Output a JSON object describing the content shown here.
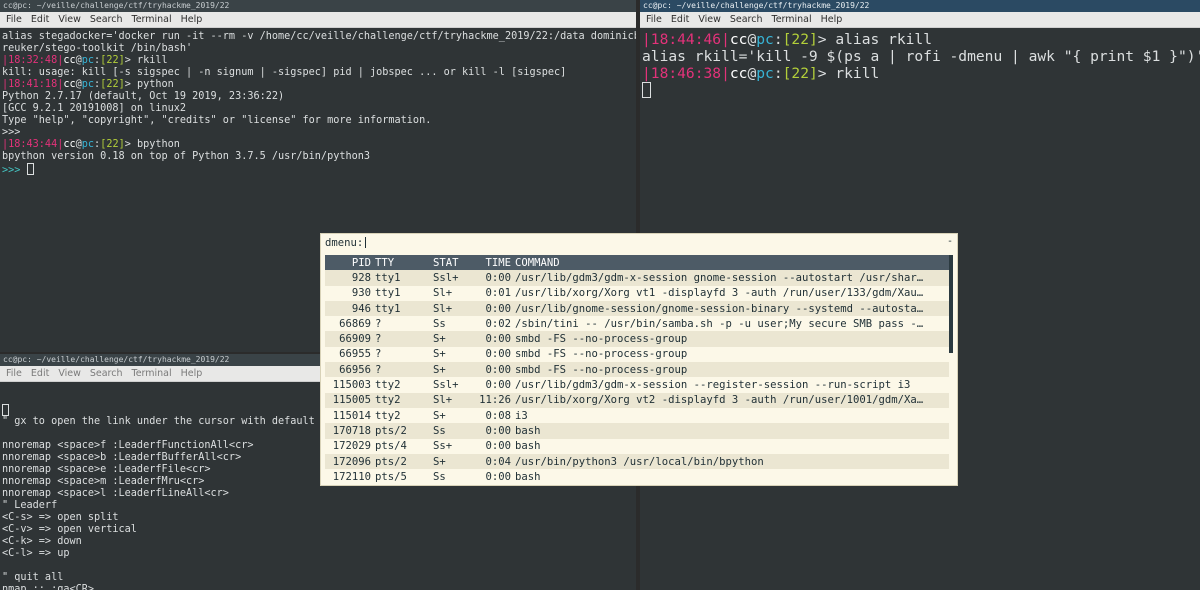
{
  "win_top_left": {
    "title": "cc@pc: ~/veille/challenge/ctf/tryhackme_2019/22",
    "menu": [
      "File",
      "Edit",
      "View",
      "Search",
      "Terminal",
      "Help"
    ],
    "lines": [
      {
        "segs": [
          {
            "t": "alias stegadocker='docker run -it --rm -v /home/cc/veille/challenge/ctf/tryhackme_2019/22:/data dominicb",
            "c": ""
          }
        ]
      },
      {
        "segs": [
          {
            "t": "reuker/stego-toolkit /bin/bash'",
            "c": ""
          }
        ]
      },
      {
        "segs": [
          {
            "t": "|18:32:48|",
            "c": "t-pink"
          },
          {
            "t": "cc",
            "c": "t-white"
          },
          {
            "t": "@",
            "c": ""
          },
          {
            "t": "pc",
            "c": "t-cyan"
          },
          {
            "t": ":",
            "c": ""
          },
          {
            "t": "[22]",
            "c": "t-green"
          },
          {
            "t": "> rkill",
            "c": ""
          }
        ]
      },
      {
        "segs": [
          {
            "t": "kill: usage: kill [-s sigspec | -n signum | -sigspec] pid | jobspec ... or kill -l [sigspec]",
            "c": ""
          }
        ]
      },
      {
        "segs": [
          {
            "t": "|18:41:18|",
            "c": "t-pink"
          },
          {
            "t": "cc",
            "c": "t-white"
          },
          {
            "t": "@",
            "c": ""
          },
          {
            "t": "pc",
            "c": "t-cyan"
          },
          {
            "t": ":",
            "c": ""
          },
          {
            "t": "[22]",
            "c": "t-green"
          },
          {
            "t": "> python",
            "c": ""
          }
        ]
      },
      {
        "segs": [
          {
            "t": "Python 2.7.17 (default, Oct 19 2019, 23:36:22)",
            "c": ""
          }
        ]
      },
      {
        "segs": [
          {
            "t": "[GCC 9.2.1 20191008] on linux2",
            "c": ""
          }
        ]
      },
      {
        "segs": [
          {
            "t": "Type \"help\", \"copyright\", \"credits\" or \"license\" for more information.",
            "c": ""
          }
        ]
      },
      {
        "segs": [
          {
            "t": ">>>",
            "c": ""
          }
        ]
      },
      {
        "segs": [
          {
            "t": "|18:43:44|",
            "c": "t-pink"
          },
          {
            "t": "cc",
            "c": "t-white"
          },
          {
            "t": "@",
            "c": ""
          },
          {
            "t": "pc",
            "c": "t-cyan"
          },
          {
            "t": ":",
            "c": ""
          },
          {
            "t": "[22]",
            "c": "t-green"
          },
          {
            "t": "> bpython",
            "c": ""
          }
        ]
      },
      {
        "segs": [
          {
            "t": "bpython version 0.18 on top of Python 3.7.5 /usr/bin/python3",
            "c": ""
          }
        ]
      },
      {
        "segs": [
          {
            "t": ">>> ",
            "c": "t-prompt"
          }
        ],
        "cursor": true
      }
    ]
  },
  "win_right": {
    "title": "cc@pc: ~/veille/challenge/ctf/tryhackme_2019/22",
    "menu": [
      "File",
      "Edit",
      "View",
      "Search",
      "Terminal",
      "Help"
    ],
    "lines": [
      {
        "segs": [
          {
            "t": "|18:44:46|",
            "c": "t-pink"
          },
          {
            "t": "cc",
            "c": "t-white"
          },
          {
            "t": "@",
            "c": ""
          },
          {
            "t": "pc",
            "c": "t-cyan"
          },
          {
            "t": ":",
            "c": ""
          },
          {
            "t": "[22]",
            "c": "t-green"
          },
          {
            "t": "> alias rkill",
            "c": ""
          }
        ]
      },
      {
        "segs": [
          {
            "t": "alias rkill='kill -9 $(ps a | rofi -dmenu | awk \"{ print $1 }\")'",
            "c": ""
          }
        ]
      },
      {
        "segs": [
          {
            "t": "|18:46:38|",
            "c": "t-pink"
          },
          {
            "t": "cc",
            "c": "t-white"
          },
          {
            "t": "@",
            "c": ""
          },
          {
            "t": "pc",
            "c": "t-cyan"
          },
          {
            "t": ":",
            "c": ""
          },
          {
            "t": "[22]",
            "c": "t-green"
          },
          {
            "t": "> rkill",
            "c": ""
          }
        ]
      },
      {
        "segs": [],
        "cursor": true
      }
    ]
  },
  "win_bottom_left": {
    "title": "cc@pc: ~/veille/challenge/ctf/tryhackme_2019/22",
    "menu": [
      "File",
      "Edit",
      "View",
      "Search",
      "Terminal",
      "Help"
    ],
    "lines": [
      {
        "segs": [],
        "cursor": true
      },
      {
        "segs": [
          {
            "t": "\" gx to open the link under the cursor with default b",
            "c": ""
          }
        ]
      },
      {
        "segs": []
      },
      {
        "segs": [
          {
            "t": "nnoremap <space>f :LeaderfFunctionAll<cr>",
            "c": ""
          }
        ]
      },
      {
        "segs": [
          {
            "t": "nnoremap <space>b :LeaderfBufferAll<cr>",
            "c": ""
          }
        ]
      },
      {
        "segs": [
          {
            "t": "nnoremap <space>e :LeaderfFile<cr>",
            "c": ""
          }
        ]
      },
      {
        "segs": [
          {
            "t": "nnoremap <space>m :LeaderfMru<cr>",
            "c": ""
          }
        ]
      },
      {
        "segs": [
          {
            "t": "nnoremap <space>l :LeaderfLineAll<cr>",
            "c": ""
          }
        ]
      },
      {
        "segs": [
          {
            "t": "\" Leaderf",
            "c": ""
          }
        ]
      },
      {
        "segs": [
          {
            "t": "<C-s> => open split",
            "c": ""
          }
        ]
      },
      {
        "segs": [
          {
            "t": "<C-v> => open vertical",
            "c": ""
          }
        ]
      },
      {
        "segs": [
          {
            "t": "<C-k> => down",
            "c": ""
          }
        ]
      },
      {
        "segs": [
          {
            "t": "<C-l> => up",
            "c": ""
          }
        ]
      },
      {
        "segs": []
      },
      {
        "segs": [
          {
            "t": "\" quit all",
            "c": ""
          }
        ]
      },
      {
        "segs": [
          {
            "t": "nmap ;; :qa<CR>",
            "c": ""
          }
        ]
      }
    ]
  },
  "dmenu": {
    "prompt": "dmenu:",
    "minus": "-",
    "columns": [
      "PID",
      "TTY",
      "STAT",
      "TIME",
      "COMMAND"
    ],
    "rows": [
      [
        "928",
        "tty1",
        "Ssl+",
        "0:00",
        "/usr/lib/gdm3/gdm-x-session gnome-session --autostart /usr/shar…"
      ],
      [
        "930",
        "tty1",
        "Sl+",
        "0:01",
        "/usr/lib/xorg/Xorg vt1 -displayfd 3 -auth /run/user/133/gdm/Xau…"
      ],
      [
        "946",
        "tty1",
        "Sl+",
        "0:00",
        "/usr/lib/gnome-session/gnome-session-binary --systemd --autosta…"
      ],
      [
        "66869",
        "?",
        "Ss",
        "0:02",
        "/sbin/tini -- /usr/bin/samba.sh -p -u user;My secure SMB pass -…"
      ],
      [
        "66909",
        "?",
        "S+",
        "0:00",
        "smbd -FS --no-process-group"
      ],
      [
        "66955",
        "?",
        "S+",
        "0:00",
        "smbd -FS --no-process-group"
      ],
      [
        "66956",
        "?",
        "S+",
        "0:00",
        "smbd -FS --no-process-group"
      ],
      [
        "115003",
        "tty2",
        "Ssl+",
        "0:00",
        "/usr/lib/gdm3/gdm-x-session --register-session --run-script i3"
      ],
      [
        "115005",
        "tty2",
        "Sl+",
        "11:26",
        "/usr/lib/xorg/Xorg vt2 -displayfd 3 -auth /run/user/1001/gdm/Xa…"
      ],
      [
        "115014",
        "tty2",
        "S+",
        "0:08",
        "i3"
      ],
      [
        "170718",
        "pts/2",
        "Ss",
        "0:00",
        "bash"
      ],
      [
        "172029",
        "pts/4",
        "Ss+",
        "0:00",
        "bash"
      ],
      [
        "172096",
        "pts/2",
        "S+",
        "0:04",
        "/usr/bin/python3 /usr/local/bin/bpython"
      ],
      [
        "172110",
        "pts/5",
        "Ss",
        "0:00",
        "bash"
      ]
    ]
  }
}
